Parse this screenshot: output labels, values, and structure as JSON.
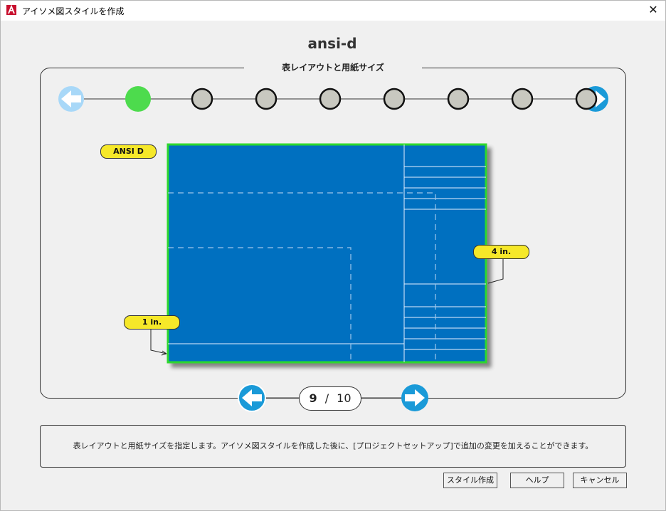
{
  "window": {
    "title": "アイソメ図スタイルを作成",
    "close_glyph": "✕",
    "app_icon": "autocad-logo-icon",
    "accent_color": "#c8102e"
  },
  "style_name": "ansi-d",
  "panel": {
    "legend": "表レイアウトと用紙サイズ",
    "current_step": 1,
    "step_count": 8,
    "step_active_color": "#4ddb4d",
    "step_inactive_color": "#c8c8c0"
  },
  "preview": {
    "sheet_label": "ANSI D",
    "left_dimension": "1 in.",
    "right_dimension": "4 in.",
    "sheet_color": "#0070c0",
    "border_color": "#2ed82e"
  },
  "pager": {
    "current": "9",
    "separator": "/",
    "total": "10"
  },
  "description": "表レイアウトと用紙サイズを指定します。アイソメ図スタイルを作成した後に、[プロジェクトセットアップ]で追加の変更を加えることができます。",
  "buttons": {
    "create": "スタイル作成",
    "help": "ヘルプ",
    "cancel": "キャンセル"
  }
}
